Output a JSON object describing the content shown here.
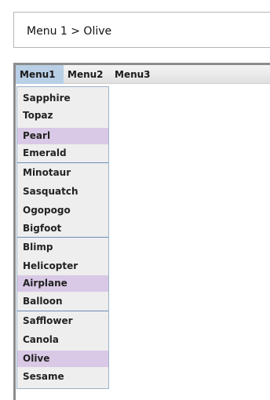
{
  "status": {
    "text": "Menu 1 > Olive"
  },
  "menubar": {
    "items": [
      "Menu1",
      "Menu2",
      "Menu3"
    ],
    "active_index": 0
  },
  "popup": {
    "groups": [
      [
        "Sapphire",
        "Topaz",
        "Pearl",
        "Emerald"
      ],
      [
        "Minotaur",
        "Sasquatch",
        "Ogopogo",
        "Bigfoot"
      ],
      [
        "Blimp",
        "Helicopter",
        "Airplane",
        "Balloon"
      ],
      [
        "Safflower",
        "Canola",
        "Olive",
        "Sesame"
      ]
    ],
    "items": [
      "Sapphire",
      "Topaz",
      "Pearl",
      "Emerald",
      "Minotaur",
      "Sasquatch",
      "Ogopogo",
      "Bigfoot",
      "Blimp",
      "Helicopter",
      "Airplane",
      "Balloon",
      "Safflower",
      "Canola",
      "Olive",
      "Sesame"
    ],
    "highlighted": [
      "Pearl",
      "Airplane",
      "Olive"
    ]
  },
  "colors": {
    "menu_highlight": "#d9c9e6",
    "menubar_active": "#b8cfe5",
    "separator": "#6b8eb3"
  }
}
